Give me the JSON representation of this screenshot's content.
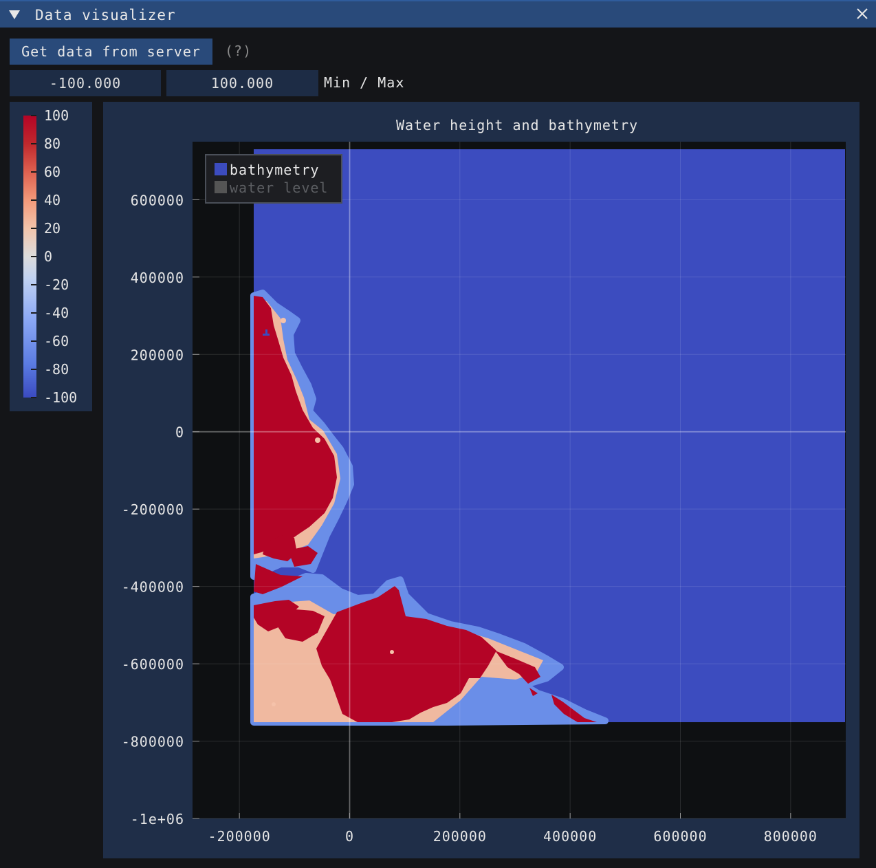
{
  "window": {
    "title": "Data visualizer",
    "collapse_icon": "triangle-down-icon",
    "close_icon": "close-icon"
  },
  "controls": {
    "get_data_label": "Get data from server",
    "help_label": "(?)",
    "min_value": "-100.000",
    "max_value": "100.000",
    "range_label": "Min / Max"
  },
  "colormap": {
    "ticks": [
      "100",
      "80",
      "60",
      "40",
      "20",
      "0",
      "-20",
      "-40",
      "-60",
      "-80",
      "-100"
    ],
    "colors": [
      "#3a4bc0",
      "#5b7ce2",
      "#8ca9f5",
      "#bfd1f2",
      "#dcdcdc",
      "#f2c4ab",
      "#f3997a",
      "#de6150",
      "#c0282d",
      "#b40426"
    ]
  },
  "plot": {
    "title": "Water height and bathymetry",
    "legend": [
      {
        "label": "bathymetry",
        "color": "#3c4cbf",
        "enabled": true
      },
      {
        "label": "water level",
        "color": "#555555",
        "enabled": false
      }
    ],
    "x_ticks": [
      "-200000",
      "0",
      "200000",
      "400000",
      "600000",
      "800000"
    ],
    "y_ticks": [
      "600000",
      "400000",
      "200000",
      "0",
      "-200000",
      "-400000",
      "-600000",
      "-800000",
      "-1e+06"
    ]
  },
  "chart_data": {
    "type": "heatmap",
    "title": "Water height and bathymetry",
    "xlabel": "",
    "ylabel": "",
    "xlim": [
      -285000,
      900000
    ],
    "ylim": [
      -1000000,
      750000
    ],
    "heatmap_extent": {
      "x": [
        -200000,
        900000
      ],
      "y": [
        -750000,
        730000
      ]
    },
    "value_range": [
      -100,
      100
    ],
    "series": [
      {
        "name": "bathymetry"
      },
      {
        "name": "water level"
      }
    ],
    "x_ticks": [
      -200000,
      0,
      200000,
      400000,
      600000,
      800000
    ],
    "y_ticks": [
      600000,
      400000,
      200000,
      0,
      -200000,
      -400000,
      -600000,
      -800000,
      -1000000
    ]
  }
}
